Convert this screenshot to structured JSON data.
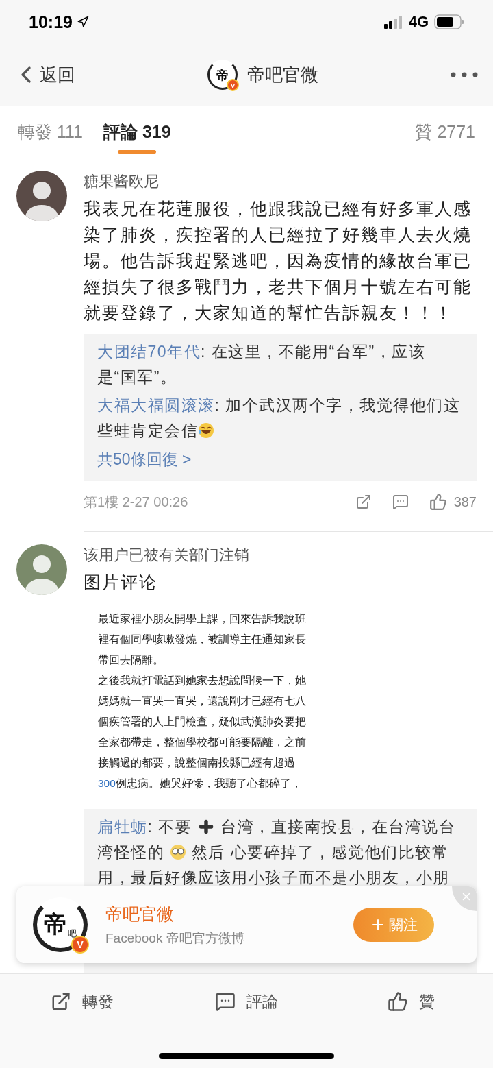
{
  "status_bar": {
    "time": "10:19",
    "network": "4G"
  },
  "nav": {
    "back": "返回",
    "logo_text": "帝",
    "verified": "V",
    "title": "帝吧官微"
  },
  "tabs": [
    {
      "label": "轉發",
      "count": "111",
      "selected": false
    },
    {
      "label": "評論",
      "count": "319",
      "selected": true
    }
  ],
  "likes_tab": {
    "label": "贊",
    "count": "2771",
    "selected": false
  },
  "comments": [
    {
      "author": "糖果酱欧尼",
      "text": "我表兄在花蓮服役，他跟我說已經有好多軍人感染了肺炎，疾控署的人已經拉了好幾車人去火燒場。他告訴我趕緊逃吧，因為疫情的緣故台軍已經損失了很多戰鬥力，老共下個月十號左右可能就要登錄了，大家知道的幫忙告訴親友！！！",
      "replies": [
        {
          "user": "大团结70年代",
          "sep": ":",
          "parts": [
            {
              "kind": "text",
              "text": "在这里，不能用“台军”，应该是“国军”。"
            }
          ]
        },
        {
          "user": "大福大福圆滚滚",
          "sep": ":",
          "parts": [
            {
              "kind": "text",
              "text": "加个武汉两个字，我觉得他们这些蛙肯定会信"
            },
            {
              "kind": "laugh"
            }
          ]
        }
      ],
      "more_replies": "共50條回復 >",
      "floor": "第1樓 2-27 00:26",
      "likes": "387"
    },
    {
      "author": "该用户已被有关部门注销",
      "text": "图片评论",
      "image_lines": [
        {
          "text": "最近家裡小朋友開學上課，回來告訴我說班"
        },
        {
          "text": "裡有個同學咳嗽發燒，被訓導主任通知家長"
        },
        {
          "text": "帶回去隔離。"
        },
        {
          "text": "之後我就打電話到她家去想說問候一下，她"
        },
        {
          "text": "媽媽就一直哭一直哭，還說剛才已經有七八"
        },
        {
          "text": "個疾管署的人上門檢查，疑似武漢肺炎要把"
        },
        {
          "text": "全家都帶走，整個學校都可能要隔離，之前"
        },
        {
          "text": "接觸過的都要，說整個南投縣已經有超過"
        },
        {
          "link": "300",
          "text": "例患病。她哭好慘，我聽了心都碎了，"
        }
      ],
      "replies": [
        {
          "user": "扁牡蛎",
          "sep": ":",
          "parts": [
            {
              "kind": "text",
              "text": "不要 "
            },
            {
              "kind": "plus"
            },
            {
              "kind": "text",
              "text": " 台湾，直接南投县，在台湾说台湾怪怪的 "
            },
            {
              "kind": "nerd"
            },
            {
              "kind": "text",
              "text": "  然后 心要碎掉了，感觉他们比较常用，最后好像应该用小孩子而不是小朋友，小朋"
            }
          ]
        }
      ]
    }
  ],
  "popup": {
    "logo_text": "帝",
    "logo_small": "吧",
    "verified": "V",
    "name": "帝吧官微",
    "subtitle": "Facebook 帝吧官方微博",
    "follow": "關注"
  },
  "bottom_bar": [
    {
      "kind": "share",
      "label": "轉發"
    },
    {
      "kind": "comment",
      "label": "評論"
    },
    {
      "kind": "like",
      "label": "贊"
    }
  ]
}
